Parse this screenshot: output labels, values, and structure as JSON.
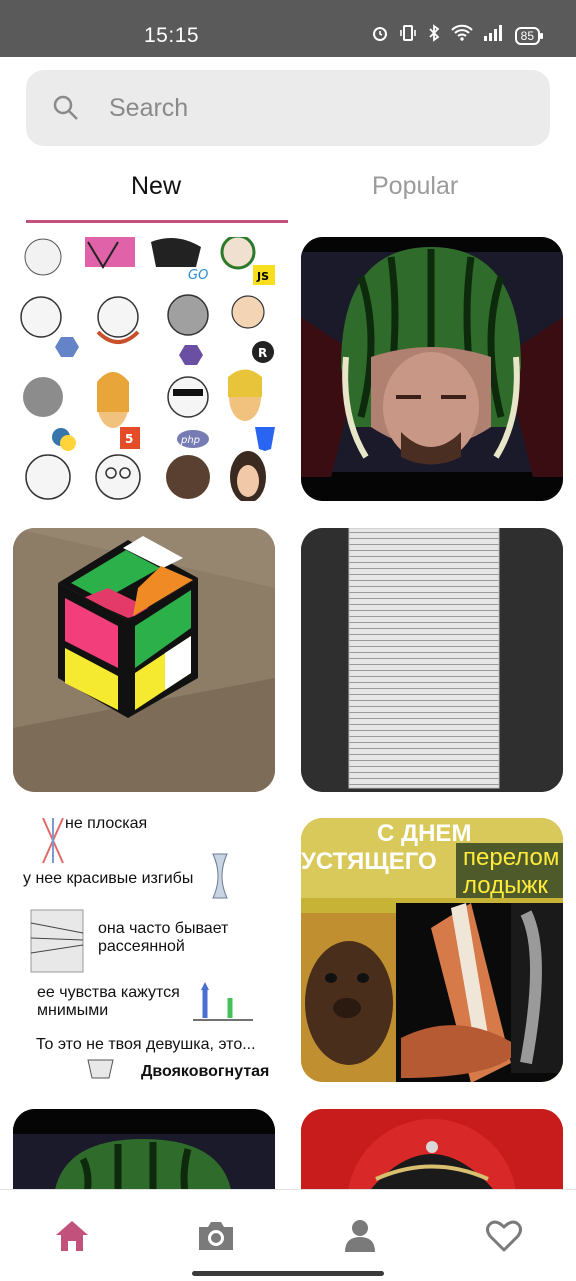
{
  "status_bar": {
    "time": "15:15",
    "battery": "85",
    "icons": [
      "alarm-icon",
      "vibrate-icon",
      "bluetooth-icon",
      "wifi-icon",
      "signal-icon",
      "battery-icon"
    ]
  },
  "search": {
    "placeholder": "Search"
  },
  "tabs": [
    {
      "label": "New",
      "active": true
    },
    {
      "label": "Popular",
      "active": false
    }
  ],
  "feed": {
    "items": [
      {
        "name": "programming-language-memes",
        "tags": [
          "GO",
          "JS",
          "php"
        ]
      },
      {
        "name": "watermelon-helmet-man"
      },
      {
        "name": "rubiks-cube"
      },
      {
        "name": "blurry-document-photo"
      },
      {
        "name": "russian-lens-meme",
        "lines": [
          "не плоская",
          "у нее красивые изгибы",
          "она часто бывает рассеянной",
          "ее чувства кажутся мнимыми",
          "То это не твоя девушка, это...",
          "Двояковогнутая"
        ]
      },
      {
        "name": "broken-ankle-greeting",
        "lines": [
          "С ДНЕМ",
          "УСТЯЩЕГО",
          "перелом",
          "лодыжк"
        ]
      },
      {
        "name": "watermelon-helmet-partial"
      },
      {
        "name": "red-uniform-partial"
      }
    ]
  },
  "bottom_nav": {
    "items": [
      {
        "name": "home-icon",
        "active": true
      },
      {
        "name": "camera-icon",
        "active": false
      },
      {
        "name": "profile-icon",
        "active": false
      },
      {
        "name": "heart-icon",
        "active": false
      }
    ],
    "active_color": "#c2527c",
    "inactive_color": "#7a7a7a"
  }
}
